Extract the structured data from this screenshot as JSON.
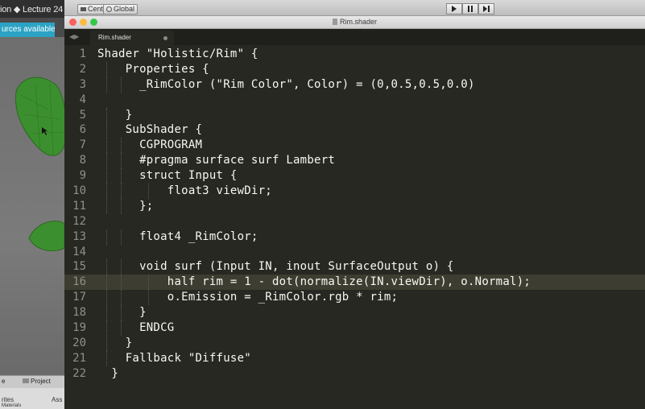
{
  "unity": {
    "title_fragment": "ion ◆ Lecture 24",
    "banner": "urces available",
    "bottom_tabs": [
      "e",
      "Project"
    ],
    "bottom_panel": [
      "rites",
      "Materials",
      "Ass"
    ]
  },
  "toolbar": {
    "center_label": "Center",
    "global_label": "Global"
  },
  "window": {
    "title": "Rim.shader"
  },
  "tab": {
    "label": "Rim.shader"
  },
  "editor": {
    "current_line": 16,
    "lines": [
      {
        "n": "1",
        "text": "Shader \"Holistic/Rim\" {"
      },
      {
        "n": "2",
        "text": "    Properties {"
      },
      {
        "n": "3",
        "text": "      _RimColor (\"Rim Color\", Color) = (0,0.5,0.5,0.0)"
      },
      {
        "n": "4",
        "text": ""
      },
      {
        "n": "5",
        "text": "    }"
      },
      {
        "n": "6",
        "text": "    SubShader {"
      },
      {
        "n": "7",
        "text": "      CGPROGRAM"
      },
      {
        "n": "8",
        "text": "      #pragma surface surf Lambert"
      },
      {
        "n": "9",
        "text": "      struct Input {"
      },
      {
        "n": "10",
        "text": "          float3 viewDir;"
      },
      {
        "n": "11",
        "text": "      };"
      },
      {
        "n": "12",
        "text": ""
      },
      {
        "n": "13",
        "text": "      float4 _RimColor;"
      },
      {
        "n": "14",
        "text": ""
      },
      {
        "n": "15",
        "text": "      void surf (Input IN, inout SurfaceOutput o) {"
      },
      {
        "n": "16",
        "text": "          half rim = 1 - dot(normalize(IN.viewDir), o.Normal);"
      },
      {
        "n": "17",
        "text": "          o.Emission = _RimColor.rgb * rim;"
      },
      {
        "n": "18",
        "text": "      }"
      },
      {
        "n": "19",
        "text": "      ENDCG"
      },
      {
        "n": "20",
        "text": "    }"
      },
      {
        "n": "21",
        "text": "    Fallback \"Diffuse\""
      },
      {
        "n": "22",
        "text": "  }"
      }
    ]
  },
  "colors": {
    "editor_bg": "#272822",
    "current_line_bg": "#3e3d32",
    "text": "#f8f8f2",
    "gutter_text": "#8f908a",
    "unity_banner": "#2aa3c5"
  }
}
